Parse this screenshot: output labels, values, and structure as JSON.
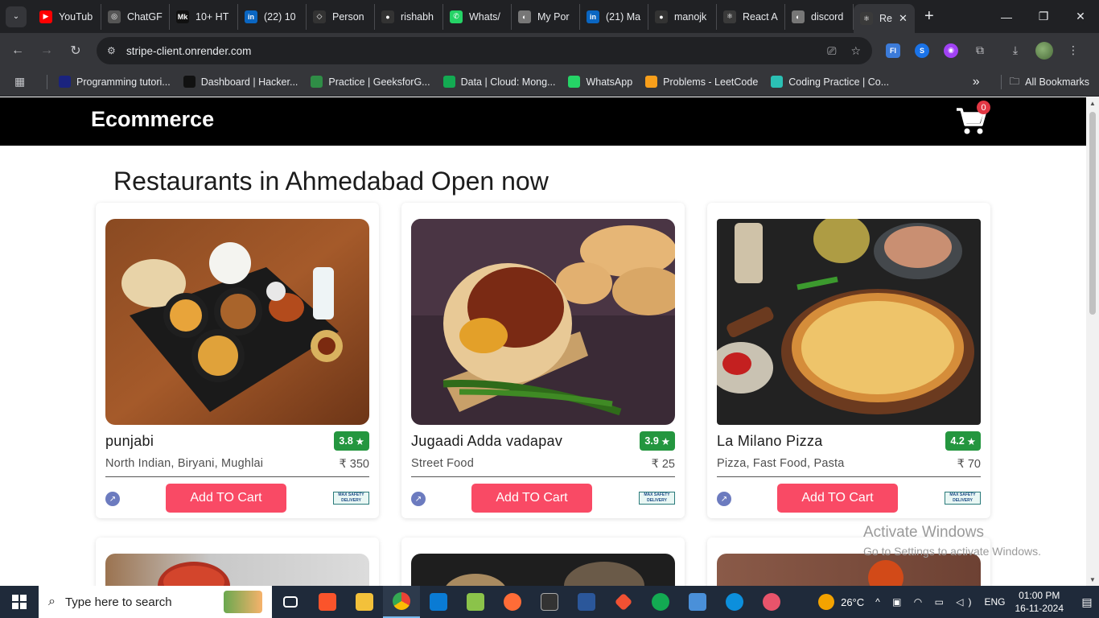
{
  "browser": {
    "tabs": [
      {
        "label": "YouTub",
        "fav_color": "#ff0000",
        "fav_glyph": "▶"
      },
      {
        "label": "ChatGF",
        "fav_color": "#555555",
        "fav_glyph": "◎"
      },
      {
        "label": "10+ HT",
        "fav_color": "#111111",
        "fav_glyph": "Mk"
      },
      {
        "label": "(22) 10",
        "fav_color": "#0a66c2",
        "fav_glyph": "in"
      },
      {
        "label": "Person",
        "fav_color": "#333333",
        "fav_glyph": "◇"
      },
      {
        "label": "rishabh",
        "fav_color": "#333333",
        "fav_glyph": "●"
      },
      {
        "label": "Whats/",
        "fav_color": "#25d366",
        "fav_glyph": "✆"
      },
      {
        "label": "My Por",
        "fav_color": "#777777",
        "fav_glyph": "◐"
      },
      {
        "label": "(21) Ma",
        "fav_color": "#0a66c2",
        "fav_glyph": "in"
      },
      {
        "label": "manojk",
        "fav_color": "#333333",
        "fav_glyph": "●"
      },
      {
        "label": "React A",
        "fav_color": "#3a3a3a",
        "fav_glyph": "⚛"
      },
      {
        "label": "discord",
        "fav_color": "#777777",
        "fav_glyph": "◐"
      },
      {
        "label": "Re",
        "fav_color": "#3a3a3a",
        "fav_glyph": "⚛",
        "active": true
      }
    ],
    "new_tab_glyph": "+",
    "url": "stripe-client.onrender.com",
    "bookmarks": [
      {
        "label": "Programming tutori...",
        "fav_color": "#1a237e"
      },
      {
        "label": "Dashboard | Hacker...",
        "fav_color": "#111111"
      },
      {
        "label": "Practice | GeeksforG...",
        "fav_color": "#2f8d46"
      },
      {
        "label": "Data | Cloud: Mong...",
        "fav_color": "#13aa52"
      },
      {
        "label": "WhatsApp",
        "fav_color": "#25d366"
      },
      {
        "label": "Problems - LeetCode",
        "fav_color": "#f89f1b"
      },
      {
        "label": "Coding Practice | Co...",
        "fav_color": "#2bc0b4"
      }
    ],
    "all_bookmarks": "All Bookmarks",
    "overflow": "»"
  },
  "site": {
    "brand": "Ecommerce",
    "cart_count": "0",
    "heading": "Restaurants in Ahmedabad Open now",
    "restaurants": [
      {
        "name": "punjabi",
        "rating": "3.8",
        "cuisine": "North Indian, Biryani, Mughlai",
        "price": "₹ 350",
        "button": "Add TO Cart",
        "badge": "MAX SAFETY DELIVERY"
      },
      {
        "name": "Jugaadi Adda vadapav",
        "rating": "3.9",
        "cuisine": "Street Food",
        "price": "₹ 25",
        "button": "Add TO Cart",
        "badge": "MAX SAFETY DELIVERY"
      },
      {
        "name": "La Milano Pizza",
        "rating": "4.2",
        "cuisine": "Pizza, Fast Food, Pasta",
        "price": "₹ 70",
        "button": "Add TO Cart",
        "badge": "MAX SAFETY DELIVERY"
      }
    ],
    "star": "★",
    "rating_color": "#24963f",
    "button_color": "#f94a65"
  },
  "windows": {
    "activate_title": "Activate Windows",
    "activate_sub": "Go to Settings to activate Windows.",
    "search_placeholder": "Type here to search",
    "temperature": "26°C",
    "language": "ENG",
    "time": "01:00 PM",
    "date": "16-11-2024"
  }
}
